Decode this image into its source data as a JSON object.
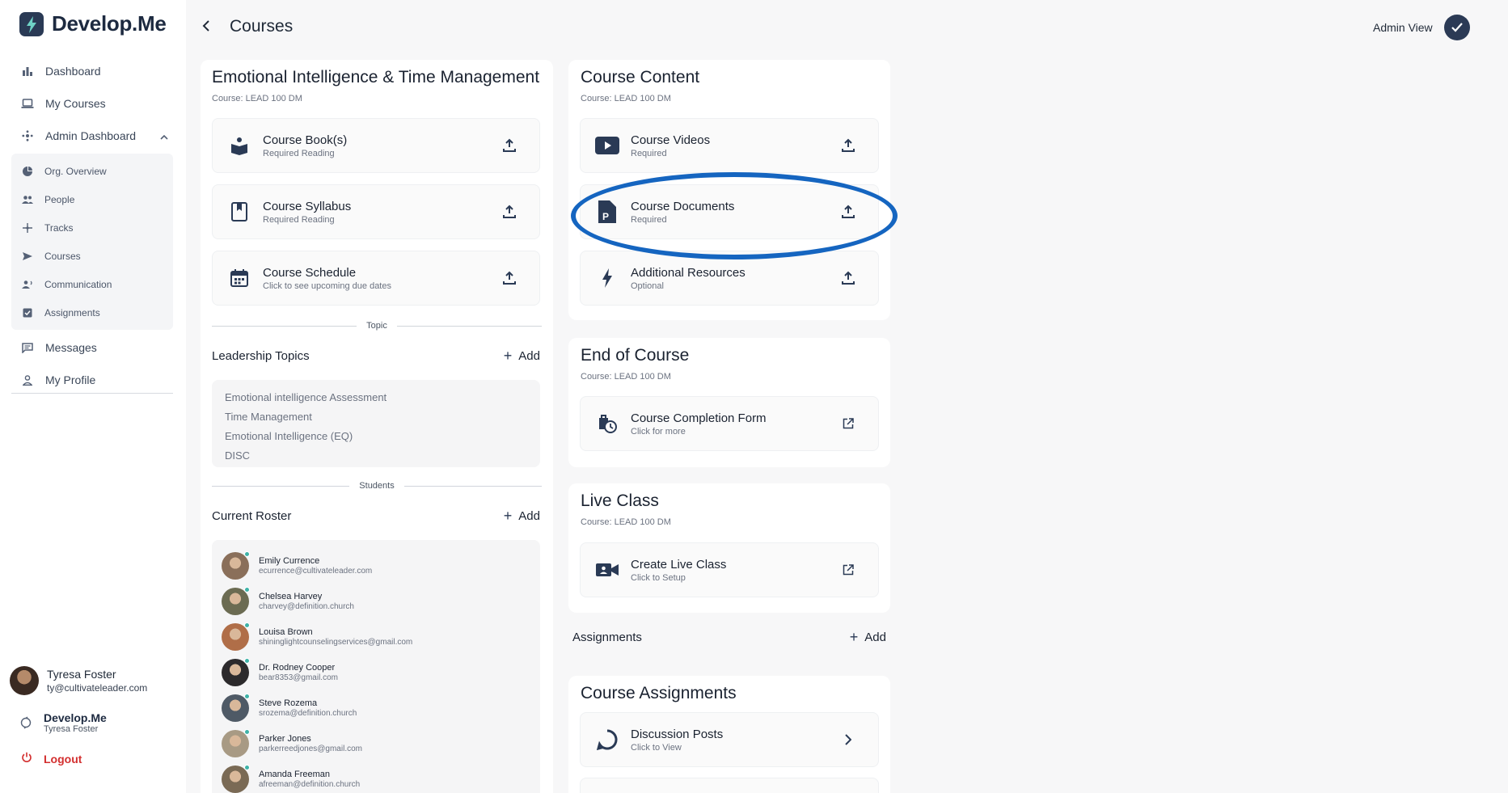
{
  "app": {
    "name": "Develop.Me"
  },
  "sidebar": {
    "nav": [
      {
        "label": "Dashboard",
        "icon": "bar-chart-icon"
      },
      {
        "label": "My Courses",
        "icon": "laptop-icon"
      },
      {
        "label": "Admin Dashboard",
        "icon": "hub-icon"
      }
    ],
    "admin_sub": [
      {
        "label": "Org. Overview",
        "icon": "pie-chart-icon"
      },
      {
        "label": "People",
        "icon": "people-icon"
      },
      {
        "label": "Tracks",
        "icon": "tracks-icon"
      },
      {
        "label": "Courses",
        "icon": "send-icon"
      },
      {
        "label": "Communication",
        "icon": "communication-icon"
      },
      {
        "label": "Assignments",
        "icon": "assignment-check-icon"
      }
    ],
    "bottom_nav": [
      {
        "label": "Messages",
        "icon": "message-icon"
      },
      {
        "label": "My Profile",
        "icon": "profile-icon"
      }
    ],
    "user": {
      "name": "Tyresa Foster",
      "email": "ty@cultivateleader.com"
    },
    "org": {
      "name": "Develop.Me",
      "sub": "Tyresa Foster"
    },
    "logout_label": "Logout"
  },
  "header": {
    "title": "Courses",
    "admin_view_label": "Admin View"
  },
  "course": {
    "title": "Emotional Intelligence & Time Management",
    "code": "Course: LEAD 100 DM",
    "items": [
      {
        "title": "Course Book(s)",
        "sub": "Required Reading"
      },
      {
        "title": "Course Syllabus",
        "sub": "Required Reading"
      },
      {
        "title": "Course Schedule",
        "sub": "Click to see upcoming due dates"
      }
    ],
    "topic_divider": "Topic",
    "topics_label": "Leadership Topics",
    "add_label": "Add",
    "topics": [
      "Emotional intelligence Assessment",
      "Time Management",
      "Emotional Intelligence (EQ)",
      "DISC"
    ],
    "students_divider": "Students",
    "roster_label": "Current Roster",
    "students": [
      {
        "name": "Emily Currence",
        "email": "ecurrence@cultivateleader.com",
        "color": "#8a6f5a"
      },
      {
        "name": "Chelsea Harvey",
        "email": "charvey@definition.church",
        "color": "#6b6b52"
      },
      {
        "name": "Louisa Brown",
        "email": "shininglightcounselingservices@gmail.com",
        "color": "#b06e48"
      },
      {
        "name": "Dr. Rodney Cooper",
        "email": "bear8353@gmail.com",
        "color": "#2c2a2c"
      },
      {
        "name": "Steve Rozema",
        "email": "srozema@definition.church",
        "color": "#4f5a66"
      },
      {
        "name": "Parker Jones",
        "email": "parkerreedjones@gmail.com",
        "color": "#a89a84"
      },
      {
        "name": "Amanda Freeman",
        "email": "afreeman@definition.church",
        "color": "#7a6a55"
      }
    ]
  },
  "content": {
    "title": "Course Content",
    "code": "Course: LEAD 100 DM",
    "items": [
      {
        "title": "Course Videos",
        "sub": "Required"
      },
      {
        "title": "Course Documents",
        "sub": "Required"
      },
      {
        "title": "Additional Resources",
        "sub": "Optional"
      }
    ]
  },
  "end_of_course": {
    "title": "End of Course",
    "code": "Course: LEAD 100 DM",
    "item": {
      "title": "Course Completion Form",
      "sub": "Click for more"
    }
  },
  "live_class": {
    "title": "Live Class",
    "code": "Course: LEAD 100 DM",
    "item": {
      "title": "Create Live Class",
      "sub": "Click to Setup"
    }
  },
  "assignments": {
    "label": "Assignments",
    "add_label": "Add",
    "card_title": "Course Assignments",
    "item": {
      "title": "Discussion Posts",
      "sub": "Click to View"
    }
  },
  "colors": {
    "accent": "#2a3a55",
    "highlight": "#1565c0",
    "logout": "#d32f2f",
    "online": "#3fb3a8"
  }
}
